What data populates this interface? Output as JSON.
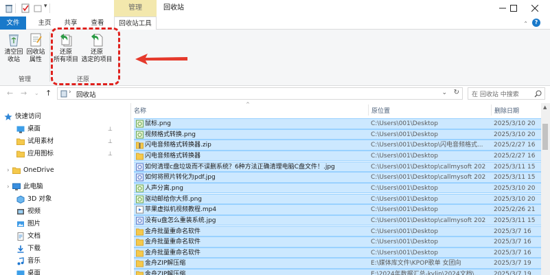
{
  "window": {
    "contextual_tab": "管理",
    "title": "回收站",
    "controls": {
      "minimize": "—",
      "maximize": "☐",
      "close": "✕"
    }
  },
  "tabs": [
    {
      "label": "文件"
    },
    {
      "label": "主页"
    },
    {
      "label": "共享"
    },
    {
      "label": "查看"
    },
    {
      "label": "回收站工具"
    }
  ],
  "help": "?",
  "ribbon": {
    "empty_bin_lines": [
      "清空回",
      "收站"
    ],
    "bin_props_lines": [
      "回收站",
      "属性"
    ],
    "restore_all_lines": [
      "还原",
      "所有项目"
    ],
    "restore_selected_lines": [
      "还原",
      "选定的项目"
    ],
    "group_manage": "管理",
    "group_restore": "还原"
  },
  "address": {
    "path": "回收站",
    "search_placeholder": "在 回收站 中搜索"
  },
  "nav": [
    {
      "label": "快速访问",
      "icon": "star-icon",
      "pinned": false
    },
    {
      "label": "桌面",
      "icon": "desktop-folder-icon",
      "pinned": true
    },
    {
      "label": "试用素材",
      "icon": "folder-icon",
      "pinned": true
    },
    {
      "label": "应用图标",
      "icon": "folder-icon",
      "pinned": true
    },
    {
      "label": "OneDrive",
      "icon": "onedrive-folder-icon",
      "pinned": false
    },
    {
      "label": "此电脑",
      "icon": "pc-icon",
      "pinned": false
    },
    {
      "label": "3D 对象",
      "icon": "3d-objects-icon",
      "pinned": false
    },
    {
      "label": "视频",
      "icon": "video-icon",
      "pinned": false
    },
    {
      "label": "图片",
      "icon": "pictures-icon",
      "pinned": false
    },
    {
      "label": "文档",
      "icon": "documents-icon",
      "pinned": false
    },
    {
      "label": "下载",
      "icon": "download-icon",
      "pinned": false
    },
    {
      "label": "音乐",
      "icon": "music-icon",
      "pinned": false
    },
    {
      "label": "桌面",
      "icon": "desktop-folder-icon",
      "pinned": false
    }
  ],
  "columns": {
    "name": "名称",
    "location": "原位置",
    "deleted": "删除日期"
  },
  "files": [
    {
      "name": "鼠标.png",
      "location": "C:\\Users\\001\\Desktop",
      "deleted": "2025/3/10 20",
      "icon": "image-file-icon"
    },
    {
      "name": "视频格式转换.png",
      "location": "C:\\Users\\001\\Desktop",
      "deleted": "2025/3/10 20",
      "icon": "image-file-icon"
    },
    {
      "name": "闪电音频格式转换器.zip",
      "location": "C:\\Users\\001\\Desktop\\闪电音频格式...",
      "deleted": "2025/2/27 16",
      "icon": "zip-file-icon"
    },
    {
      "name": "闪电音频格式转换器",
      "location": "C:\\Users\\001\\Desktop",
      "deleted": "2025/2/27 16",
      "icon": "folder-icon"
    },
    {
      "name": "如何清理c盘垃圾而不误删系统？6种方法正确清理电脑C盘文件！.jpg",
      "location": "C:\\Users\\001\\Desktop\\callmysoft 202...",
      "deleted": "2025/3/11 15",
      "icon": "jpg-file-icon"
    },
    {
      "name": "如何将照片转化为pdf.jpg",
      "location": "C:\\Users\\001\\Desktop\\callmysoft 202...",
      "deleted": "2025/3/11 15",
      "icon": "jpg-file-icon"
    },
    {
      "name": "人声分离.png",
      "location": "C:\\Users\\001\\Desktop",
      "deleted": "2025/3/10 20",
      "icon": "image-file-icon"
    },
    {
      "name": "驱动邮给你大师.png",
      "location": "C:\\Users\\001\\Desktop",
      "deleted": "2025/3/10 20",
      "icon": "image-file-icon"
    },
    {
      "name": "苹果虚拟机视频教程.mp4",
      "location": "C:\\Users\\001\\Desktop",
      "deleted": "2025/2/26 21",
      "icon": "video-file-icon"
    },
    {
      "name": "没有u盘怎么重装系统.jpg",
      "location": "C:\\Users\\001\\Desktop\\callmysoft 202...",
      "deleted": "2025/3/11 15",
      "icon": "jpg-file-icon"
    },
    {
      "name": "金舟批量重命名软件",
      "location": "C:\\Users\\001\\Desktop",
      "deleted": "2025/3/7 16",
      "icon": "folder-icon"
    },
    {
      "name": "金舟批量重命名软件",
      "location": "C:\\Users\\001\\Desktop",
      "deleted": "2025/3/7 16",
      "icon": "folder-icon"
    },
    {
      "name": "金舟批量重命名软件",
      "location": "C:\\Users\\001\\Desktop",
      "deleted": "2025/3/7 16",
      "icon": "folder-icon"
    },
    {
      "name": "金舟ZIP解压缩",
      "location": "E:\\媒体库文件\\KPOP歌单 女团向",
      "deleted": "2025/3/7 19",
      "icon": "folder-icon"
    },
    {
      "name": "金舟ZIP解压缩",
      "location": "E:\\2024年数据汇总-kylin\\2024文档\\...",
      "deleted": "2025/3/7 19",
      "icon": "folder-icon"
    }
  ]
}
